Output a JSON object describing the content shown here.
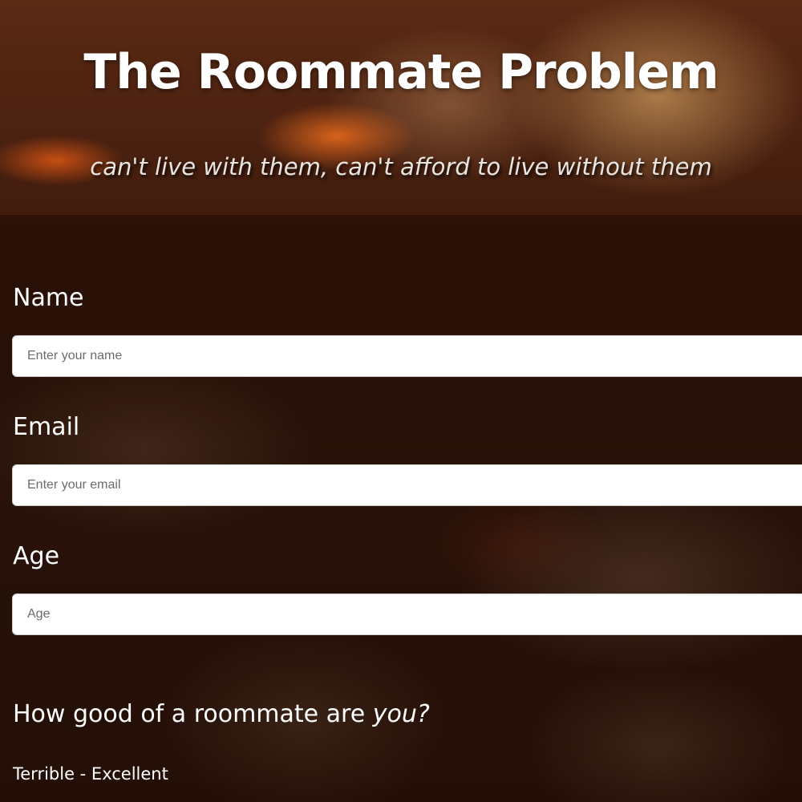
{
  "header": {
    "title": "The Roommate Problem",
    "subtitle": "can't live with them, can't afford to live without them"
  },
  "form": {
    "name": {
      "label": "Name",
      "placeholder": "Enter your name"
    },
    "email": {
      "label": "Email",
      "placeholder": "Enter your email"
    },
    "age": {
      "label": "Age",
      "placeholder": "Age"
    },
    "rating": {
      "question_prefix": "How good of a roommate are ",
      "question_emphasis": "you?",
      "scale_label": "Terrible - Excellent"
    }
  }
}
